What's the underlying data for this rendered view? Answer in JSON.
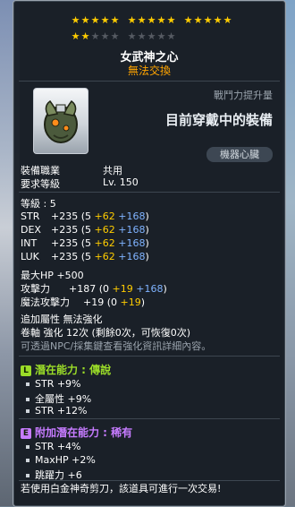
{
  "stars": {
    "row1_groups": [
      5,
      5,
      5
    ],
    "row1_filled": 15,
    "row2_total": 10,
    "row2_filled": 2,
    "star_symbol": "★"
  },
  "item": {
    "name": "女武神之心",
    "trade": "無法交換",
    "icon_name": "valkyrie-heart-icon"
  },
  "power": {
    "label": "戰鬥力提升量",
    "value": "目前穿戴中的裝備",
    "category_tag": "機器心臟"
  },
  "requirements": {
    "job_label": "裝備職業",
    "job_value": "共用",
    "level_label": "要求等級",
    "level_value": "Lv. 150"
  },
  "stats": {
    "grade": "等級 : 5",
    "lines": [
      {
        "name": "STR",
        "total": "+235",
        "base": "5",
        "enhance": "+62",
        "star": "+168"
      },
      {
        "name": "DEX",
        "total": "+235",
        "base": "5",
        "enhance": "+62",
        "star": "+168"
      },
      {
        "name": "INT",
        "total": "+235",
        "base": "5",
        "enhance": "+62",
        "star": "+168"
      },
      {
        "name": "LUK",
        "total": "+235",
        "base": "5",
        "enhance": "+62",
        "star": "+168"
      }
    ],
    "maxhp": "最大HP  +500",
    "attack_label": "攻擊力",
    "attack_total": "+187",
    "attack_base": "0",
    "attack_enh": "+19",
    "attack_star": "+168",
    "magic_label": "魔法攻擊力",
    "magic_total": "+19",
    "magic_base": "0",
    "magic_enh": "+19"
  },
  "enhance_text": "追加屬性 無法強化",
  "scroll_text": "卷軸 強化 12次 (剩餘0次，可恢復0次)",
  "hint_text": "可透過NPC/採集鍵查看強化資訊詳細內容。",
  "potential": {
    "badge": "L",
    "badge_color": "#9bdc28",
    "title": "潛在能力 : 傳說",
    "title_color": "#9bdc28",
    "lines": [
      "STR +9%",
      "全屬性 +9%",
      "STR +12%"
    ]
  },
  "additional": {
    "badge": "E",
    "badge_color": "#c67bff",
    "title": "附加潛在能力 : 稀有",
    "title_color": "#c67bff",
    "lines": [
      "STR +4%",
      "MaxHP +2%",
      "跳躍力 +6"
    ]
  },
  "footer": "若使用白金神奇剪刀，該道具可進行一次交易!"
}
